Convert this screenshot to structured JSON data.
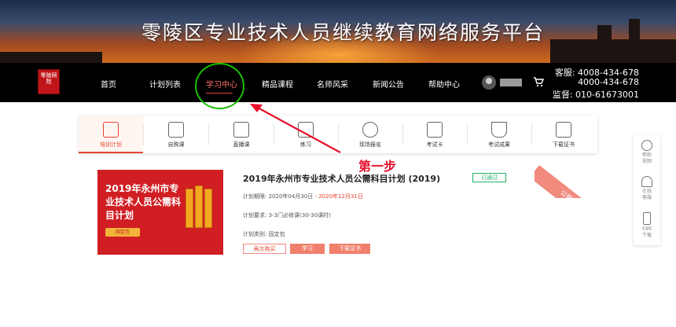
{
  "banner": {
    "title": "零陵区专业技术人员继续教育网络服务平台"
  },
  "logo": {
    "text": "零陵网院"
  },
  "nav": {
    "items": [
      "首页",
      "计划列表",
      "学习中心",
      "精品课程",
      "名师风采",
      "新闻公告",
      "帮助中心"
    ],
    "active_index": 2
  },
  "contact": {
    "customer_service_1": "客服: 4008-434-678",
    "customer_service_2": "4000-434-678",
    "supervision": "监督: 010-61673001"
  },
  "menu": {
    "items": [
      {
        "label": "培训计划",
        "icon": "calendar-icon"
      },
      {
        "label": "自购课",
        "icon": "video-play-icon"
      },
      {
        "label": "直播课",
        "icon": "live-play-icon"
      },
      {
        "label": "练习",
        "icon": "edit-icon"
      },
      {
        "label": "现场报名",
        "icon": "user-icon"
      },
      {
        "label": "考试卡",
        "icon": "id-card-icon"
      },
      {
        "label": "考试成果",
        "icon": "trophy-icon"
      },
      {
        "label": "下载证书",
        "icon": "certificate-icon"
      }
    ],
    "active_index": 0
  },
  "annotation": {
    "step_label": "第一步"
  },
  "plan": {
    "cover_title": "2019年永州市专业技术人员公需科目计划",
    "cover_badge": "固定包",
    "title": "2019年永州市专业技术人员公需科目计划 (2019)",
    "status": "已通过",
    "corner_tag": "公需课",
    "period_label": "计划期限: ",
    "period_start": "2020年04月30日",
    "period_sep": " - ",
    "period_end": "2020年12月31日",
    "requirement": "计划要求: 3-3门必修课(30-30课时)",
    "category": "计划类别: 固定包",
    "buttons": {
      "rebuy": "再次购买",
      "study": "学习",
      "download": "下载证书"
    }
  },
  "side_tools": [
    {
      "label": "帮助视频",
      "icon": "play-circle-icon"
    },
    {
      "label": "在线客服",
      "icon": "headset-icon"
    },
    {
      "label": "扫码下载",
      "icon": "phone-icon"
    }
  ],
  "colors": {
    "accent": "#e8432e",
    "nav_bg": "#000000",
    "success": "#23b06a",
    "annotation": "#e8102a"
  }
}
